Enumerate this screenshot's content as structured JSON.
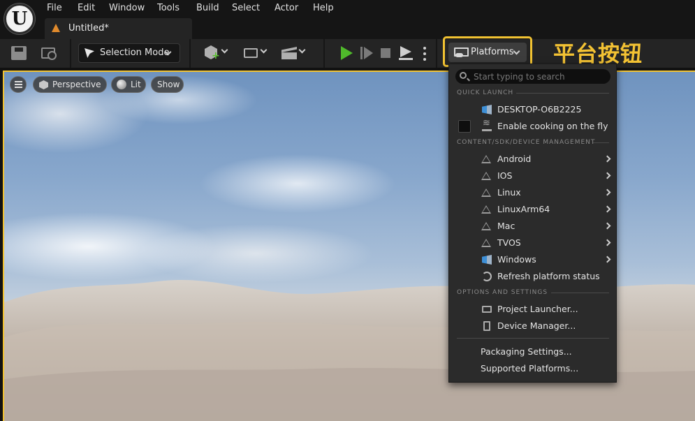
{
  "menubar": {
    "logo_letter": "U",
    "items": [
      "File",
      "Edit",
      "Window",
      "Tools",
      "Build",
      "Select",
      "Actor",
      "Help"
    ],
    "document_tab": "Untitled*"
  },
  "toolbar": {
    "selection_mode_label": "Selection Mode",
    "platforms_label": "Platforms",
    "play_color": "#4fb92b",
    "highlight_color": "#f1c232"
  },
  "annotation": {
    "text": "平台按钮"
  },
  "viewport": {
    "perspective_label": "Perspective",
    "lit_label": "Lit",
    "show_label": "Show"
  },
  "platforms_menu": {
    "search_placeholder": "Start typing to search",
    "quick_launch_header": "QUICK LAUNCH",
    "device_name": "DESKTOP-O6B2225",
    "cooking_label": "Enable cooking on the fly",
    "management_header": "CONTENT/SDK/DEVICE MANAGEMENT",
    "platforms": [
      {
        "label": "Android",
        "icon": "warning-icon"
      },
      {
        "label": "IOS",
        "icon": "warning-icon"
      },
      {
        "label": "Linux",
        "icon": "warning-icon"
      },
      {
        "label": "LinuxArm64",
        "icon": "warning-icon"
      },
      {
        "label": "Mac",
        "icon": "warning-icon"
      },
      {
        "label": "TVOS",
        "icon": "warning-icon"
      },
      {
        "label": "Windows",
        "icon": "windows-icon"
      }
    ],
    "refresh_label": "Refresh platform status",
    "options_header": "OPTIONS AND SETTINGS",
    "project_launcher_label": "Project Launcher...",
    "device_manager_label": "Device Manager...",
    "packaging_settings_label": "Packaging Settings...",
    "supported_platforms_label": "Supported Platforms..."
  }
}
